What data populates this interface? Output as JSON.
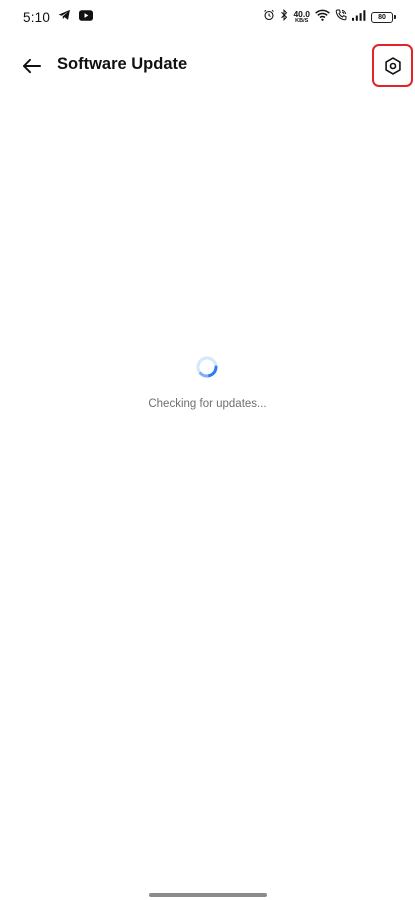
{
  "status_bar": {
    "time": "5:10",
    "net_speed_value": "40.0",
    "net_speed_unit": "KB/S",
    "battery_level": "80",
    "left_icons": [
      "telegram-icon",
      "youtube-icon"
    ],
    "right_icons": [
      "alarm-icon",
      "bluetooth-icon",
      "wifi-icon",
      "wifi-calling-icon",
      "cellular-signal-icon",
      "battery-icon"
    ]
  },
  "header": {
    "title": "Software Update",
    "back_icon": "arrow-left-icon",
    "settings_icon": "hexagon-settings-icon",
    "highlight_color": "#e0242a"
  },
  "main": {
    "status_text": "Checking for updates...",
    "spinner_color": "#2f7bf5"
  }
}
